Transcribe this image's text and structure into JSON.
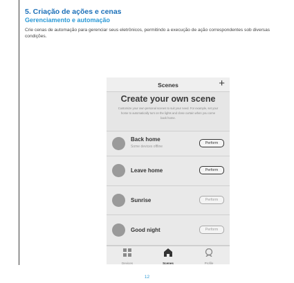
{
  "section": {
    "title": "5. Criação de ações e cenas",
    "subtitle": "Gerenciamento e automação",
    "body": "Crie cenas de automação para gerenciar seus eletrônicos, permitindo a execução de ação correspondentes sob diversas condições."
  },
  "phone": {
    "header_title": "Scenes",
    "add_icon": "+",
    "intro_title": "Create your own scene",
    "intro_text": "Customize your own personal scenes to suit your need. For example, set your home to automatically turn on the lights and close curtain when you come back home.",
    "scenes": [
      {
        "name": "Back home",
        "status": "Some devices offline",
        "action": "Perform",
        "action_enabled": true
      },
      {
        "name": "Leave home",
        "status": "",
        "action": "Perform",
        "action_enabled": true
      },
      {
        "name": "Sunrise",
        "status": "",
        "action": "Perform",
        "action_enabled": false
      },
      {
        "name": "Good night",
        "status": "",
        "action": "Perform",
        "action_enabled": false
      }
    ],
    "tabs": [
      {
        "label": "Devices",
        "icon": "grid-icon",
        "active": false
      },
      {
        "label": "Scenes",
        "icon": "home-icon",
        "active": true
      },
      {
        "label": "Profile",
        "icon": "profile-icon",
        "active": false
      }
    ]
  },
  "page_number": "12",
  "colors": {
    "heading": "#1a6fb8",
    "subheading": "#2c9ad6",
    "phone_bg": "#e6e6e6"
  }
}
